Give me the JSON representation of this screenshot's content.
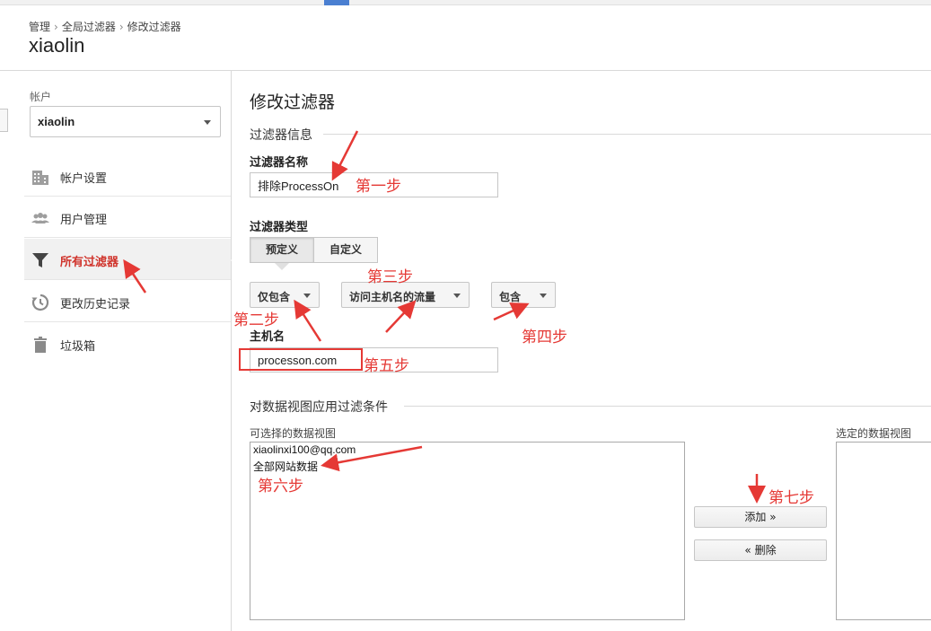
{
  "breadcrumb": [
    "管理",
    "全局过滤器",
    "修改过滤器"
  ],
  "page_title": "xiaolin",
  "sidebar": {
    "account_label": "帐户",
    "account_value": "xiaolin",
    "items": [
      {
        "label": "帐户设置",
        "icon": "building-icon"
      },
      {
        "label": "用户管理",
        "icon": "people-icon"
      },
      {
        "label": "所有过滤器",
        "icon": "filter-icon",
        "active": true
      },
      {
        "label": "更改历史记录",
        "icon": "history-icon"
      },
      {
        "label": "垃圾箱",
        "icon": "trash-icon"
      }
    ]
  },
  "main": {
    "title": "修改过滤器",
    "filter_info_section": "过滤器信息",
    "filter_name_label": "过滤器名称",
    "filter_name_value": "排除ProcessOn",
    "filter_type_label": "过滤器类型",
    "type_tabs": [
      "预定义",
      "自定义"
    ],
    "dropdowns": [
      "仅包含",
      "访问主机名的流量",
      "包含"
    ],
    "hostname_label": "主机名",
    "hostname_value": "processon.com",
    "apply_section": "对数据视图应用过滤条件",
    "available_label": "可选择的数据视图",
    "available_views": [
      "xiaolinxi100@qq.com",
      "全部网站数据"
    ],
    "selected_label": "选定的数据视图",
    "add_button": "添加 »",
    "remove_button": "« 删除"
  },
  "annotations": {
    "step1": "第一步",
    "step2": "第二步",
    "step3": "第三步",
    "step4": "第四步",
    "step5": "第五步",
    "step6": "第六步",
    "step7": "第七步",
    "color": "#e53935"
  }
}
